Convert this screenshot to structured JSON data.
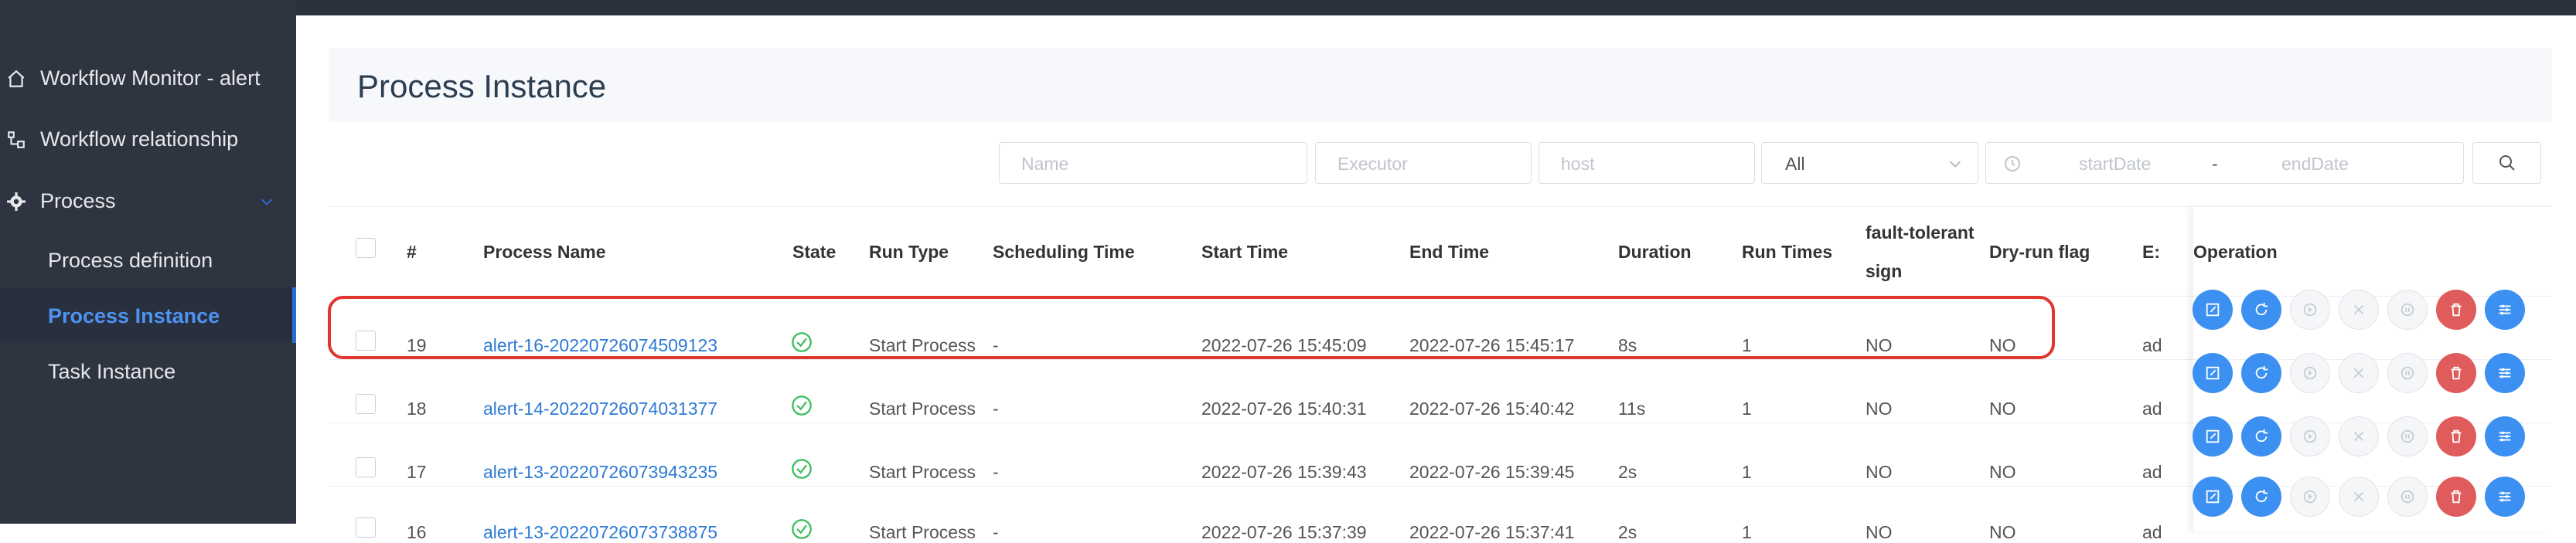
{
  "sidebar": {
    "items": [
      {
        "label": "Workflow Monitor - alert",
        "icon": "home-icon"
      },
      {
        "label": "Workflow relationship",
        "icon": "relationship-icon"
      },
      {
        "label": "Process",
        "icon": "gear-icon"
      }
    ],
    "sub_items": [
      {
        "label": "Process definition"
      },
      {
        "label": "Process Instance",
        "active": true
      },
      {
        "label": "Task Instance"
      }
    ]
  },
  "header": {
    "title": "Process Instance"
  },
  "filters": {
    "name_placeholder": "Name",
    "executor_placeholder": "Executor",
    "host_placeholder": "host",
    "state_value": "All",
    "start_date_placeholder": "startDate",
    "date_separator": "-",
    "end_date_placeholder": "endDate"
  },
  "table": {
    "columns": {
      "index": "#",
      "process_name": "Process Name",
      "state": "State",
      "run_type": "Run Type",
      "scheduling_time": "Scheduling Time",
      "start_time": "Start Time",
      "end_time": "End Time",
      "duration": "Duration",
      "run_times": "Run Times",
      "fault_tolerant_1": "fault-tolerant",
      "fault_tolerant_2": "sign",
      "dry_run": "Dry-run flag",
      "executor_trunc": "E:",
      "operation": "Operation"
    },
    "rows": [
      {
        "id": "19",
        "name": "alert-16-20220726074509123",
        "run_type": "Start Process",
        "scheduling_time": "-",
        "start_time": "2022-07-26 15:45:09",
        "end_time": "2022-07-26 15:45:17",
        "duration": "8s",
        "run_times": "1",
        "fault_tolerant": "NO",
        "dry_run": "NO",
        "executor": "ad"
      },
      {
        "id": "18",
        "name": "alert-14-20220726074031377",
        "run_type": "Start Process",
        "scheduling_time": "-",
        "start_time": "2022-07-26 15:40:31",
        "end_time": "2022-07-26 15:40:42",
        "duration": "11s",
        "run_times": "1",
        "fault_tolerant": "NO",
        "dry_run": "NO",
        "executor": "ad"
      },
      {
        "id": "17",
        "name": "alert-13-20220726073943235",
        "run_type": "Start Process",
        "scheduling_time": "-",
        "start_time": "2022-07-26 15:39:43",
        "end_time": "2022-07-26 15:39:45",
        "duration": "2s",
        "run_times": "1",
        "fault_tolerant": "NO",
        "dry_run": "NO",
        "executor": "ad"
      },
      {
        "id": "16",
        "name": "alert-13-20220726073738875",
        "run_type": "Start Process",
        "scheduling_time": "-",
        "start_time": "2022-07-26 15:37:39",
        "end_time": "2022-07-26 15:37:41",
        "duration": "2s",
        "run_times": "1",
        "fault_tolerant": "NO",
        "dry_run": "NO",
        "executor": "ad"
      }
    ]
  },
  "colors": {
    "accent": "#2d7ad6",
    "success": "#3fbf62",
    "danger": "#e05b5b",
    "highlight": "#e0362f",
    "sidebar_bg": "#2f3441"
  }
}
